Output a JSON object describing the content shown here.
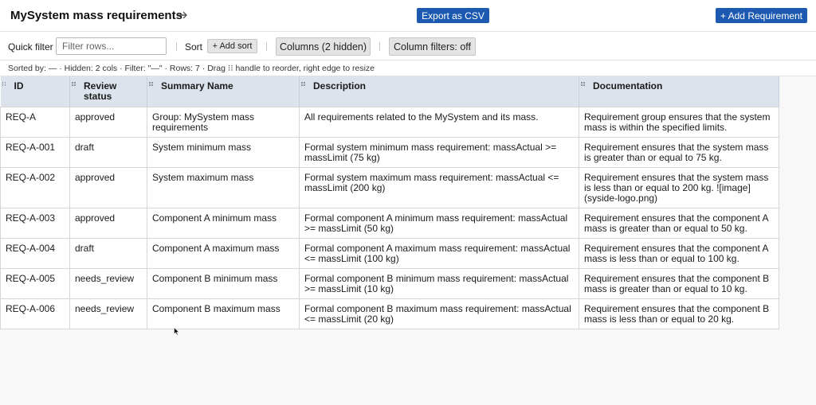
{
  "header": {
    "title": "MySystem mass requirements",
    "export_label": "Export as CSV",
    "add_label": "+ Add Requirement"
  },
  "toolbar": {
    "quick_filter_label": "Quick filter",
    "quick_filter_placeholder": "Filter rows...",
    "sort_label": "Sort",
    "add_sort_label": "+ Add sort",
    "columns_label": "Columns (2 hidden)",
    "column_filters_label": "Column filters: off"
  },
  "status": {
    "text": "Sorted by: — · Hidden: 2 cols · Filter: \"—\" · Rows: 7 · Drag ⁝⁝ handle to reorder, right edge to resize"
  },
  "table": {
    "columns": [
      "ID",
      "Review status",
      "Summary Name",
      "Description",
      "Documentation"
    ],
    "rows": [
      {
        "id": "REQ-A",
        "status": "approved",
        "name": "Group: MySystem mass requirements",
        "description": "All requirements related to the MySystem and its mass.",
        "documentation": "Requirement group ensures that the system mass is within the specified limits."
      },
      {
        "id": "REQ-A-001",
        "status": "draft",
        "name": "System minimum mass",
        "description": "Formal system minimum mass requirement: massActual >= massLimit (75 kg)",
        "documentation": "Requirement ensures that the system mass is greater than or equal to 75 kg."
      },
      {
        "id": "REQ-A-002",
        "status": "approved",
        "name": "System maximum mass",
        "description": "Formal system maximum mass requirement: massActual <= massLimit (200 kg)",
        "documentation": "Requirement ensures that the system mass is less than or equal to 200 kg. ![image](syside-logo.png)"
      },
      {
        "id": "REQ-A-003",
        "status": "approved",
        "name": "Component A minimum mass",
        "description": "Formal component A minimum mass requirement: massActual >= massLimit (50 kg)",
        "documentation": "Requirement ensures that the component A mass is greater than or equal to 50 kg."
      },
      {
        "id": "REQ-A-004",
        "status": "draft",
        "name": "Component A maximum mass",
        "description": "Formal component A maximum mass requirement: massActual <= massLimit (100 kg)",
        "documentation": "Requirement ensures that the component A mass is less than or equal to 100 kg."
      },
      {
        "id": "REQ-A-005",
        "status": "needs_review",
        "name": "Component B minimum mass",
        "description": "Formal component B minimum mass requirement: massActual >= massLimit (10 kg)",
        "documentation": "Requirement ensures that the component B mass is greater than or equal to 10 kg."
      },
      {
        "id": "REQ-A-006",
        "status": "needs_review",
        "name": "Component B maximum mass",
        "description": "Formal component B maximum mass requirement: massActual <= massLimit (20 kg)",
        "documentation": "Requirement ensures that the component B mass is less than or equal to 20 kg."
      }
    ]
  },
  "colors": {
    "primary_button": "#1c59b0",
    "header_row": "#dde3ec"
  }
}
